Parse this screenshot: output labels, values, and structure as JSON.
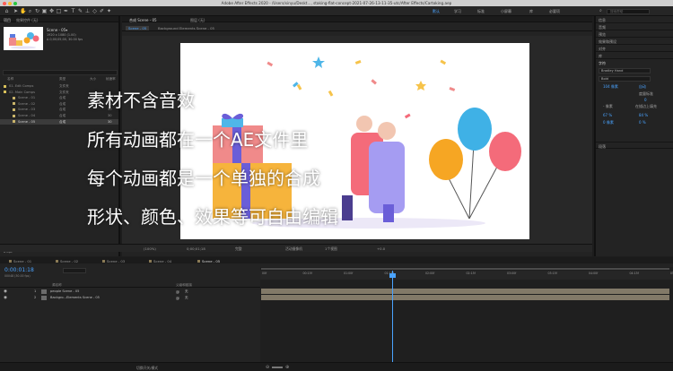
{
  "app": {
    "title": "Adobe After Effects 2020 - /Users/xinyu/Deskt..., staking-flat-concept-2021-07-26-13-11-35-utc/After Effects/Cartoking.aep"
  },
  "toolbar": {
    "workspaces": [
      "默认",
      "学习",
      "标准",
      "小屏幕",
      "库",
      "必要项"
    ],
    "active_workspace": "默认",
    "search_placeholder": "搜索帮助",
    "tool_icons": [
      "home-icon",
      "selection-tool-icon",
      "hand-tool-icon",
      "zoom-tool-icon",
      "rotate-tool-icon",
      "camera-tool-icon",
      "pan-behind-tool-icon",
      "rectangle-tool-icon",
      "pen-tool-icon",
      "type-tool-icon",
      "brush-tool-icon",
      "clone-stamp-tool-icon",
      "eraser-tool-icon",
      "roto-brush-tool-icon",
      "puppet-tool-icon"
    ]
  },
  "project": {
    "tabs": [
      "项目",
      "效果控件 (无)"
    ],
    "selected": {
      "name": "Scene - 05▾",
      "meta1": "1920 x 1080 (1.00)",
      "meta2": "Δ 0;00;05;00, 30.00 fps"
    },
    "search_placeholder": "",
    "columns": [
      "名称",
      "类型",
      "大小",
      "帧速率"
    ],
    "rows": [
      {
        "name": "01. Edit Comps",
        "type": "文件夹",
        "size": "",
        "fps": "",
        "color": "#d8c15a",
        "sel": false
      },
      {
        "name": "02. Main Comps",
        "type": "文件夹",
        "size": "",
        "fps": "",
        "color": "#d8c15a",
        "sel": false
      },
      {
        "name": "Scene - 01",
        "type": "合成",
        "size": "",
        "fps": "30",
        "color": "#c9b46a",
        "sel": false
      },
      {
        "name": "Scene - 02",
        "type": "合成",
        "size": "",
        "fps": "30",
        "color": "#c9b46a",
        "sel": false
      },
      {
        "name": "Scene - 03",
        "type": "合成",
        "size": "",
        "fps": "30",
        "color": "#c9b46a",
        "sel": false
      },
      {
        "name": "Scene - 04",
        "type": "合成",
        "size": "",
        "fps": "30",
        "color": "#c9b46a",
        "sel": false
      },
      {
        "name": "Scene - 05",
        "type": "合成",
        "size": "",
        "fps": "30",
        "color": "#c9b46a",
        "sel": true
      }
    ],
    "bpc": "8 bpc"
  },
  "comp": {
    "panel_tabs": [
      "合成 Scene - 05",
      "图层 (无)"
    ],
    "sub_tabs": [
      "Scene - 05",
      "Background Elements Scene - 05"
    ],
    "overlay_lines": [
      "素材不含音效",
      "所有动画都在一个AE文件里",
      "每个动画都是一个单独的合成",
      "形状、颜色、效果等可自由编辑"
    ]
  },
  "viewer_bar": {
    "zoom": "(100%)",
    "time": "0;00;01;18",
    "resolution": "完整",
    "camera": "活动摄像机",
    "views": "1个视图",
    "offset": "+0.0"
  },
  "right": {
    "sections": [
      "信息",
      "音频",
      "预览",
      "效果和预设",
      "对齐",
      "库",
      "字符",
      "段落"
    ],
    "font": "Bradley Hand",
    "style": "Bold",
    "size": "104 像素",
    "leading": "自动",
    "tracking": "度量标准",
    "kern": "0",
    "stroke": "- 像素",
    "stroke_mode": "在描边上填充",
    "vscale": "67 %",
    "hscale": "84 %",
    "baseline": "0 像素",
    "tsume": "0 %"
  },
  "timeline": {
    "tabs": [
      "Scene - 01",
      "Scene - 02",
      "Scene - 03",
      "Scene - 04",
      "Scene - 05"
    ],
    "timecode": "0:00:01:18",
    "frame_info": "00048 (30.00 fps)",
    "columns": [
      "源名称",
      "父级和链接"
    ],
    "layers": [
      {
        "num": "1",
        "name": "people Scene - 05",
        "parent": "无"
      },
      {
        "num": "2",
        "name": "Backgro...Elements Scene - 05",
        "parent": "无"
      }
    ],
    "ruler_labels": [
      "00f",
      "00:15f",
      "01:00f",
      "01:15f",
      "02:00f",
      "02:15f",
      "03:00f",
      "03:15f",
      "04:00f",
      "04:15f",
      "05:0"
    ],
    "playhead_fraction": 0.32,
    "status_label": "切换开关/模式"
  }
}
